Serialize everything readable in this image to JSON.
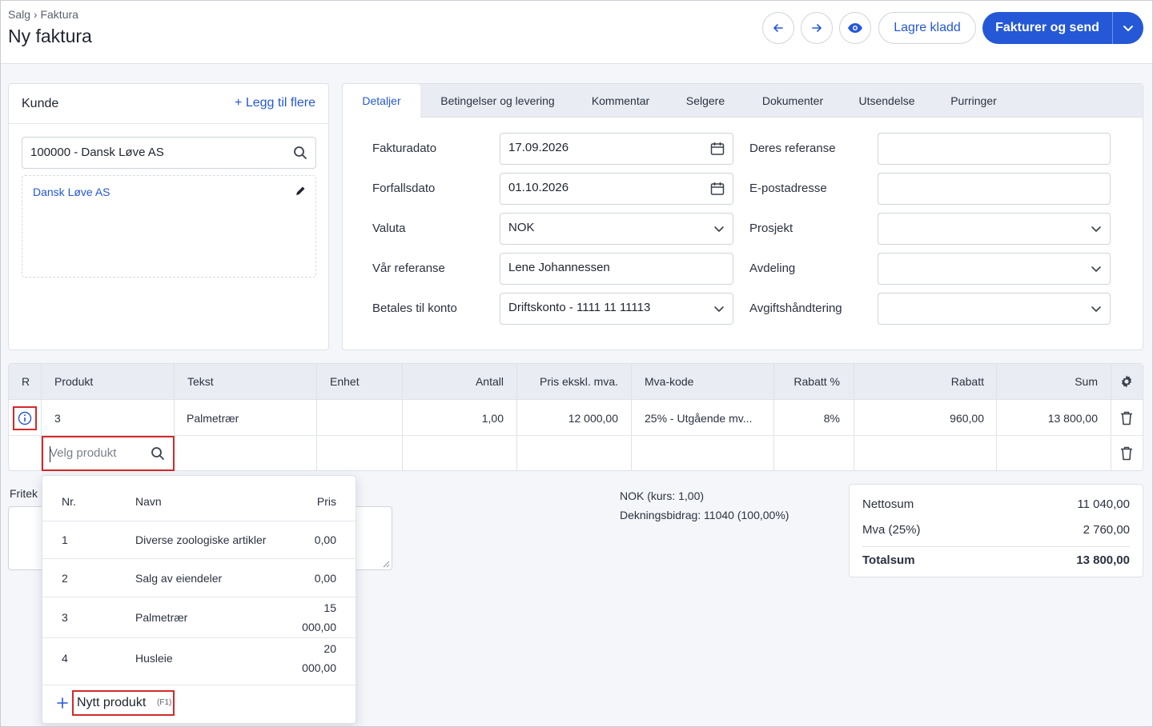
{
  "header": {
    "breadcrumb": "Salg › Faktura",
    "title": "Ny faktura",
    "save_draft": "Lagre kladd",
    "invoice_send": "Fakturer og send"
  },
  "customer": {
    "title": "Kunde",
    "add_more": "+ Legg til flere",
    "search_value": "100000 - Dansk Løve AS",
    "name": "Dansk Løve AS"
  },
  "tabs": [
    "Detaljer",
    "Betingelser og levering",
    "Kommentar",
    "Selgere",
    "Dokumenter",
    "Utsendelse",
    "Purringer"
  ],
  "details": {
    "left": [
      {
        "label": "Fakturadato",
        "value": "17.09.2026"
      },
      {
        "label": "Forfallsdato",
        "value": "01.10.2026"
      },
      {
        "label": "Valuta",
        "value": "NOK"
      },
      {
        "label": "Vår referanse",
        "value": "Lene Johannessen"
      },
      {
        "label": "Betales til konto",
        "value": "Driftskonto - 1111 11 11113"
      }
    ],
    "right": [
      {
        "label": "Deres referanse",
        "value": ""
      },
      {
        "label": "E-postadresse",
        "value": ""
      },
      {
        "label": "Prosjekt",
        "value": ""
      },
      {
        "label": "Avdeling",
        "value": ""
      },
      {
        "label": "Avgiftshåndtering",
        "value": ""
      }
    ]
  },
  "table": {
    "columns": [
      "R",
      "Produkt",
      "Tekst",
      "Enhet",
      "Antall",
      "Pris ekskl. mva.",
      "Mva-kode",
      "Rabatt %",
      "Rabatt",
      "Sum"
    ],
    "row": {
      "produkt": "3",
      "tekst": "Palmetrær",
      "enhet": "",
      "antall": "1,00",
      "pris": "12 000,00",
      "mva": "25% - Utgående mv...",
      "rabatt_pct": "8%",
      "rabatt": "960,00",
      "sum": "13 800,00"
    },
    "product_placeholder": "Velg produkt"
  },
  "fritekst_label": "Fritek",
  "dropdown": {
    "headers": {
      "nr": "Nr.",
      "navn": "Navn",
      "pris": "Pris"
    },
    "items": [
      {
        "nr": "1",
        "navn": "Diverse zoologiske artikler",
        "pris": "0,00"
      },
      {
        "nr": "2",
        "navn": "Salg av eiendeler",
        "pris": "0,00"
      },
      {
        "nr": "3",
        "navn": "Palmetrær",
        "pris_l1": "15",
        "pris_l2": "000,00"
      },
      {
        "nr": "4",
        "navn": "Husleie",
        "pris_l1": "20",
        "pris_l2": "000,00"
      }
    ],
    "new_product": "Nytt produkt",
    "new_product_key": "(F1)"
  },
  "totals": {
    "kurs": "NOK (kurs: 1,00)",
    "dekning": "Dekningsbidrag: 11040 (100,00%)",
    "netto_label": "Nettosum",
    "netto": "11 040,00",
    "mva_label": "Mva (25%)",
    "mva": "2 760,00",
    "total_label": "Totalsum",
    "total": "13 800,00"
  },
  "colors": {
    "accent": "#2458d6",
    "highlight": "#d32a2a"
  }
}
